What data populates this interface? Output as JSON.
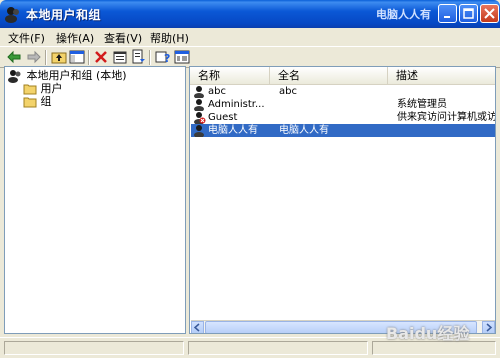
{
  "window": {
    "title": "本地用户和组",
    "title_watermark": "电脑人人有"
  },
  "menubar": {
    "items": [
      "文件(F)",
      "操作(A)",
      "查看(V)",
      "帮助(H)"
    ]
  },
  "toolbar": {
    "tools": [
      "back-arrow-icon",
      "forward-arrow-icon",
      "up-folder-icon",
      "show-hide-tree-icon",
      "delete-icon",
      "properties-icon",
      "export-icon",
      "help-icon",
      "console-icon"
    ]
  },
  "tree": {
    "root": "本地用户和组 (本地)",
    "children": [
      "用户",
      "组"
    ]
  },
  "list": {
    "columns": [
      "名称",
      "全名",
      "描述"
    ],
    "rows": [
      {
        "name": "abc",
        "fullname": "abc",
        "description": "",
        "icon": "user-icon"
      },
      {
        "name": "Administr...",
        "fullname": "",
        "description": "系统管理员",
        "icon": "user-icon"
      },
      {
        "name": "Guest",
        "fullname": "",
        "description": "供来宾访问计算机或访问",
        "icon": "user-disabled-icon"
      },
      {
        "name": "电脑人人有",
        "fullname": "电脑人人有",
        "description": "",
        "icon": "user-icon",
        "selected": true
      }
    ]
  },
  "watermark": {
    "text": "Baidu经验"
  }
}
